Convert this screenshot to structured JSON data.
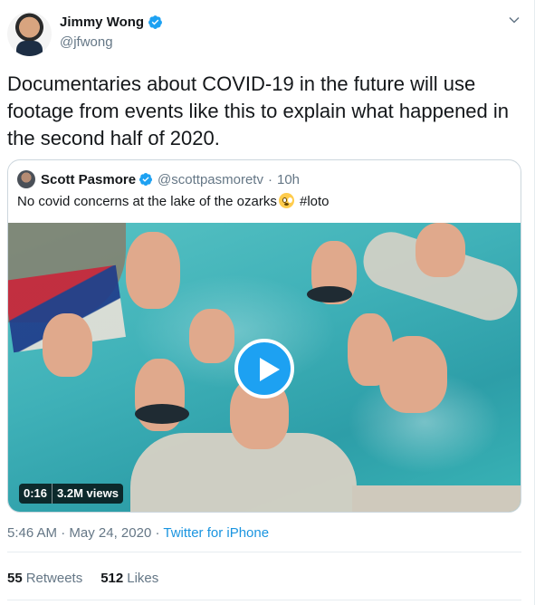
{
  "author": {
    "name": "Jimmy Wong",
    "handle": "@jfwong",
    "verified": true,
    "avatar_icon": "avatar"
  },
  "menu_icon": "chevron-down-icon",
  "tweet": {
    "text": "Documentaries about COVID-19 in the future will use footage from events like this to explain what happened in the second half of 2020."
  },
  "quoted": {
    "name": "Scott Pasmore",
    "handle": "@scottpasmoretv",
    "separator": "·",
    "time": "10h",
    "text_before": "No covid concerns at the lake of the ozarks",
    "emoji": "flushed-face-emoji",
    "text_after": " #loto",
    "video": {
      "duration": "0:16",
      "views": "3.2M views",
      "play_icon": "play-icon"
    }
  },
  "meta": {
    "time": "5:46 AM",
    "dot": " · ",
    "date": "May 24, 2020",
    "source": "Twitter for iPhone"
  },
  "stats": {
    "retweets_count": "55",
    "retweets_label": "Retweets",
    "likes_count": "512",
    "likes_label": "Likes"
  },
  "colors": {
    "link": "#1b95e0",
    "secondary_text": "#657786",
    "primary_text": "#14171a",
    "play_button": "#1da1f2"
  }
}
